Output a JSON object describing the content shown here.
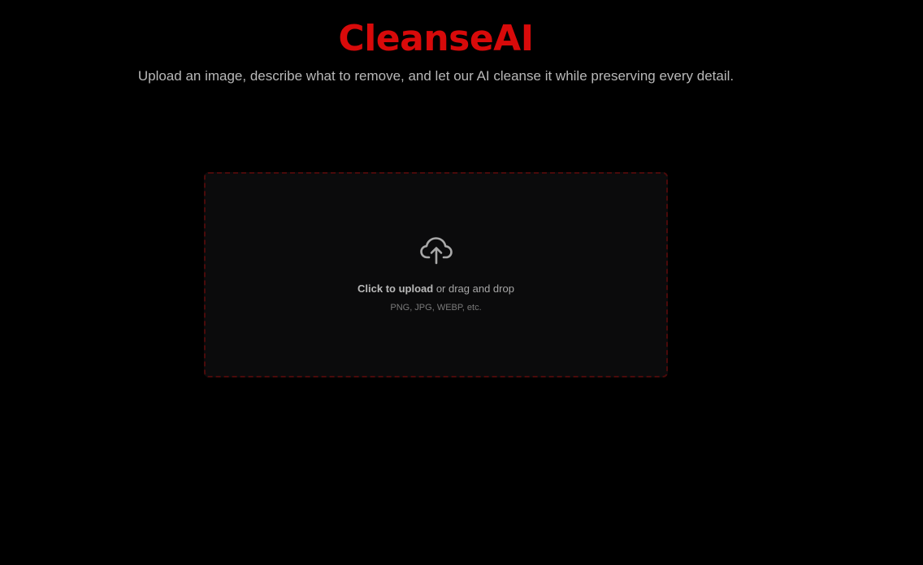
{
  "header": {
    "title": "CleanseAI",
    "subtitle": "Upload an image, describe what to remove, and let our AI cleanse it while preserving every detail."
  },
  "upload": {
    "icon": "cloud-upload-icon",
    "cta_strong": "Click to upload",
    "cta_rest": " or drag and drop",
    "hint": "PNG, JPG, WEBP, etc."
  },
  "colors": {
    "background": "#000000",
    "brand": "#d80a0a",
    "subtitle": "#b8b8b8",
    "dropzone_border": "#4a0a0a",
    "dropzone_bg": "#0b0b0c",
    "icon": "#a9a9a9"
  }
}
